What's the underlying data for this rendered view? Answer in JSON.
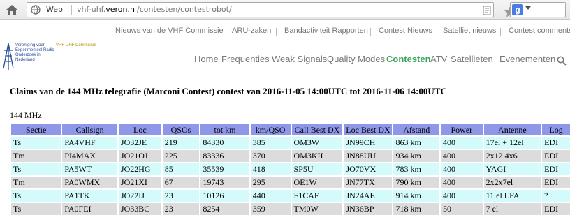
{
  "browser": {
    "web_label": "Web",
    "url_host": "vhf-uhf.",
    "url_domain": "veron.nl",
    "url_path": "/contesten/contestrobot/",
    "search_engine_letter": "g"
  },
  "site": {
    "top_nav": [
      "Nieuws van de VHF Commissie",
      "IARU-zaken",
      "Bandactiviteit Rapporten",
      "Contest Nieuws",
      "Satelliet nieuws",
      "Contest comments"
    ],
    "logo_text": "Vereniging voor Experimenteel Radio Onderzoek in Nederland",
    "vhf_text": "VHF-UHF Commissie",
    "main_nav": [
      "Home",
      "Frequenties",
      "Weak Signals",
      "Quality Modes",
      "Contesten",
      "ATV",
      "Satellieten",
      "Evenementen"
    ],
    "active_nav": "Contesten"
  },
  "page": {
    "title": "Claims van de 144 MHz telegrafie (Marconi Contest) contest van 2016-11-05 14:00UTC tot 2016-11-06 14:00UTC",
    "band": "144 MHz"
  },
  "table": {
    "headers": [
      "Sectie",
      "Callsign",
      "Loc",
      "QSOs",
      "tot km",
      "km/QSO",
      "Call Best DX",
      "Loc Best DX",
      "Afstand",
      "Power",
      "Antenne",
      "Log"
    ],
    "rows": [
      [
        "Ts",
        "PA4VHF",
        "JO32JE",
        "219",
        "84330",
        "385",
        "OM3W",
        "JN99CH",
        "863 km",
        "400",
        "17el + 12el",
        "EDI"
      ],
      [
        "Tm",
        "PI4MAX",
        "JO21OJ",
        "225",
        "83336",
        "370",
        "OM3KII",
        "JN88UU",
        "934 km",
        "400",
        "2x12 4x6",
        "EDI"
      ],
      [
        "Ts",
        "PA5WT",
        "JO22HG",
        "85",
        "35539",
        "418",
        "SP5U",
        "JO70VX",
        "783 km",
        "400",
        "YAGI",
        "EDI"
      ],
      [
        "Tm",
        "PA0WMX",
        "JO21XI",
        "67",
        "19743",
        "295",
        "OE1W",
        "JN77TX",
        "790 km",
        "400",
        "2x2x7el",
        "EDI"
      ],
      [
        "Ts",
        "PA1TK",
        "JO22IJ",
        "23",
        "10126",
        "440",
        "F1CAE",
        "JN24AE",
        "914 km",
        "400",
        "11 el LFA",
        "?"
      ],
      [
        "Ts",
        "PA0FEI",
        "JO33BC",
        "23",
        "8254",
        "359",
        "TM0W",
        "JN36BP",
        "718 km",
        "50",
        "7 el",
        "EDI"
      ]
    ]
  },
  "colors": {
    "header_bg": "#8e97e8",
    "row_odd": "#d3fbfc",
    "row_even": "#dcdcdc",
    "active_nav": "#3aa65b"
  }
}
